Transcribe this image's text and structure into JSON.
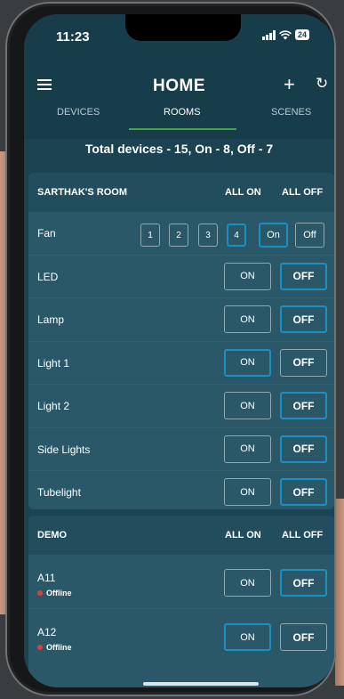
{
  "status_bar": {
    "time": "11:23",
    "battery": "24"
  },
  "header": {
    "title": "HOME",
    "add_icon": "plus-icon",
    "refresh_icon": "refresh-icon",
    "menu_icon": "menu-icon"
  },
  "tabs": [
    {
      "label": "DEVICES",
      "active": false
    },
    {
      "label": "ROOMS",
      "active": true
    },
    {
      "label": "SCENES",
      "active": false
    }
  ],
  "summary": "Total devices - 15, On - 8,  Off - 7",
  "rooms": [
    {
      "name": "SARTHAK'S ROOM",
      "all_on": "ALL ON",
      "all_off": "ALL OFF",
      "fan": {
        "label": "Fan",
        "speeds": [
          "1",
          "2",
          "3",
          "4"
        ],
        "selected_speed": "4",
        "on_label": "On",
        "off_label": "Off",
        "state": "on"
      },
      "devices": [
        {
          "label": "LED",
          "on_label": "ON",
          "off_label": "OFF",
          "state": "off"
        },
        {
          "label": "Lamp",
          "on_label": "ON",
          "off_label": "OFF",
          "state": "off"
        },
        {
          "label": "Light 1",
          "on_label": "ON",
          "off_label": "OFF",
          "state": "on"
        },
        {
          "label": "Light 2",
          "on_label": "ON",
          "off_label": "OFF",
          "state": "off"
        },
        {
          "label": "Side Lights",
          "on_label": "ON",
          "off_label": "OFF",
          "state": "off"
        },
        {
          "label": "Tubelight",
          "on_label": "ON",
          "off_label": "OFF",
          "state": "off"
        }
      ]
    },
    {
      "name": "DEMO",
      "all_on": "ALL ON",
      "all_off": "ALL OFF",
      "devices": [
        {
          "label": "A11",
          "status": "Offline",
          "on_label": "ON",
          "off_label": "OFF",
          "state": "off"
        },
        {
          "label": "A12",
          "status": "Offline",
          "on_label": "ON",
          "off_label": "OFF",
          "state": "on"
        }
      ]
    }
  ],
  "colors": {
    "background": "#1b4352",
    "card": "#2a5869",
    "accent": "#1a8fc2",
    "tab_indicator": "#43a64b",
    "offline": "#e03e3e"
  }
}
